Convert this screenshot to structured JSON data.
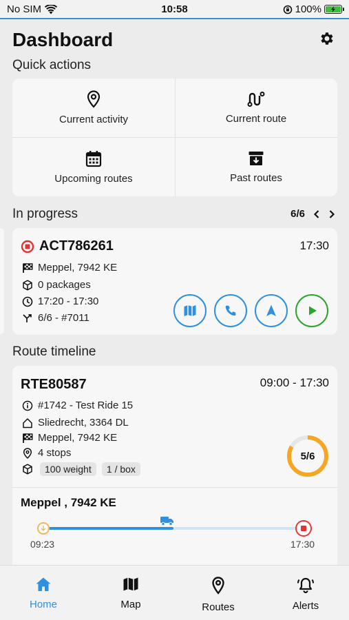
{
  "status_bar": {
    "carrier": "No SIM",
    "time": "10:58",
    "battery": "100%"
  },
  "header": {
    "title": "Dashboard"
  },
  "quick_actions": {
    "label": "Quick actions",
    "items": [
      {
        "label": "Current activity",
        "icon": "location-pin-icon"
      },
      {
        "label": "Current route",
        "icon": "route-icon"
      },
      {
        "label": "Upcoming routes",
        "icon": "calendar-icon"
      },
      {
        "label": "Past routes",
        "icon": "archive-icon"
      }
    ]
  },
  "in_progress": {
    "label": "In progress",
    "pager": "6/6",
    "activity": {
      "id": "ACT786261",
      "time": "17:30",
      "destination": "Meppel, 7942 KE",
      "packages": "0 packages",
      "window": "17:20 - 17:30",
      "sequence": "6/6 - #7011"
    }
  },
  "route_timeline": {
    "label": "Route timeline",
    "route": {
      "id": "RTE80587",
      "time": "09:00 - 17:30",
      "ride": "#1742 - Test Ride 15",
      "origin": "Sliedrecht, 3364 DL",
      "destination": "Meppel, 7942 KE",
      "stops": "4 stops",
      "weight": "100 weight",
      "per_box": "1 / box",
      "progress_label": "5/6",
      "progress": 0.8333
    },
    "timeline": {
      "stop_name": "Meppel , 7942 KE",
      "start_time": "09:23",
      "end_time": "17:30",
      "progress": 0.5
    }
  },
  "tabs": [
    {
      "label": "Home",
      "icon": "home-icon",
      "active": true
    },
    {
      "label": "Map",
      "icon": "map-icon"
    },
    {
      "label": "Routes",
      "icon": "location-pin-icon"
    },
    {
      "label": "Alerts",
      "icon": "bell-icon"
    }
  ],
  "colors": {
    "accent": "#2f8fe0",
    "stop": "#e33333",
    "start": "#2aa52a",
    "progress": "#f5a623"
  }
}
